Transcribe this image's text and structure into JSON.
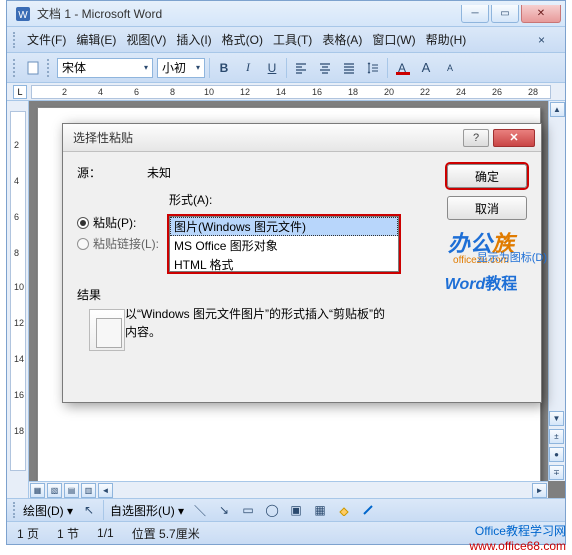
{
  "window": {
    "title": "文档 1 - Microsoft Word"
  },
  "menu": {
    "file": "文件(F)",
    "edit": "编辑(E)",
    "view": "视图(V)",
    "insert": "插入(I)",
    "format": "格式(O)",
    "tools": "工具(T)",
    "table": "表格(A)",
    "window": "窗口(W)",
    "help": "帮助(H)",
    "ask": "×"
  },
  "toolbar": {
    "font": "宋体",
    "size": "小初",
    "bold": "B",
    "italic": "I",
    "underline": "U",
    "fontcolor": "A",
    "highlight": "A",
    "charborder": "A"
  },
  "dialog": {
    "title": "选择性粘贴",
    "source_label": "源：",
    "source_value": "未知",
    "format_label": "形式(A):",
    "paste_label": "粘贴(P):",
    "pastelink_label": "粘贴链接(L):",
    "formats": {
      "opt1": "图片(Windows 图元文件)",
      "opt2": "MS Office 图形对象",
      "opt3": "HTML 格式"
    },
    "ok": "确定",
    "cancel": "取消",
    "result_label": "结果",
    "result_text": "以“Windows 图元文件图片”的形式插入“剪贴板”的内容。"
  },
  "watermark": {
    "brand_a": "办公",
    "brand_b": "族",
    "domain": "officezu.com",
    "tag": "Word",
    "tag2": "教程",
    "side": "显示为图标(D)"
  },
  "drawbar": {
    "draw": "绘图(D)",
    "autoshape": "自选图形(U)"
  },
  "status": {
    "page": "1 页",
    "section": "1 节",
    "pageof": "1/1",
    "pos": "位置 5.7厘米"
  },
  "footer": {
    "cn": "Office教程学习网",
    "url": "www.office68.com"
  }
}
